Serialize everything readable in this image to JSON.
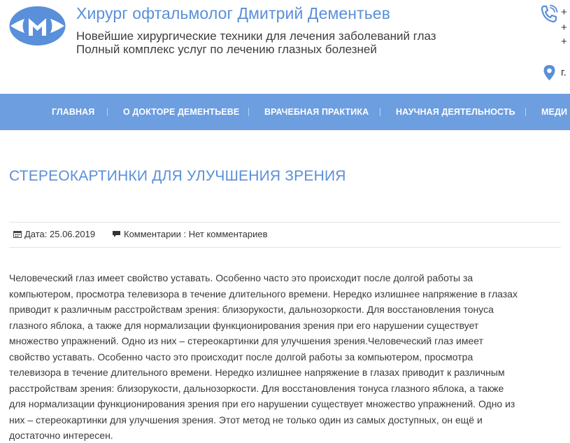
{
  "header": {
    "site_title": "Хирург офтальмолог Дмитрий Дементьев",
    "tagline_1": "Новейшие хирургические техники для лечения заболеваний глаз",
    "tagline_2": "Полный комплекс услуг по лечению глазных болезней",
    "phones": [
      "+",
      "+",
      "+"
    ],
    "address": "г.",
    "icons": {
      "logo": "eye-logo",
      "phone": "phone-icon",
      "location": "pin-icon"
    }
  },
  "nav": {
    "items": [
      {
        "label": "ГЛАВНАЯ"
      },
      {
        "label": "О ДОКТОРЕ ДЕМЕНТЬЕВЕ"
      },
      {
        "label": "ВРАЧЕБНАЯ ПРАКТИКА"
      },
      {
        "label": "НАУЧНАЯ ДЕЯТЕЛЬНОСТЬ"
      },
      {
        "label": "МЕДИ"
      }
    ]
  },
  "article": {
    "title": "СТЕРЕОКАРТИНКИ ДЛЯ УЛУЧШЕНИЯ ЗРЕНИЯ",
    "date_text": "Дата: 25.06.2019",
    "comments_text": "Комментарии : Нет комментариев",
    "body_lines": [
      "Человеческий глаз имеет свойство уставать. Особенно часто это происходит после долгой работы за",
      "компьютером, просмотра телевизора в течение длительного времени. Нередко излишнее напряжение в глазах",
      "приводит к различным расстройствам зрения: близорукости, дальнозоркости. Для восстановления тонуса",
      "глазного яблока, а также для нормализации функционирования зрения при его нарушении существует",
      "множество упражнений. Одно из них – стереокартинки для улучшения зрения.Человеческий глаз имеет",
      "свойство уставать. Особенно часто это происходит после долгой работы за компьютером, просмотра",
      "телевизора в течение длительного времени. Нередко излишнее напряжение в глазах приводит к различным",
      "расстройствам зрения: близорукости, дальнозоркости. Для восстановления тонуса глазного яблока, а также",
      "для нормализации функционирования зрения при его нарушении существует множество упражнений. Одно из",
      "них – стереокартинки для улучшения зрения. Этот метод не только один из самых доступных, он ещё и",
      "достаточно интересен."
    ]
  },
  "colors": {
    "accent": "#5a8fd9",
    "nav_bg": "#6c9ee0",
    "text": "#3a3a3a"
  }
}
